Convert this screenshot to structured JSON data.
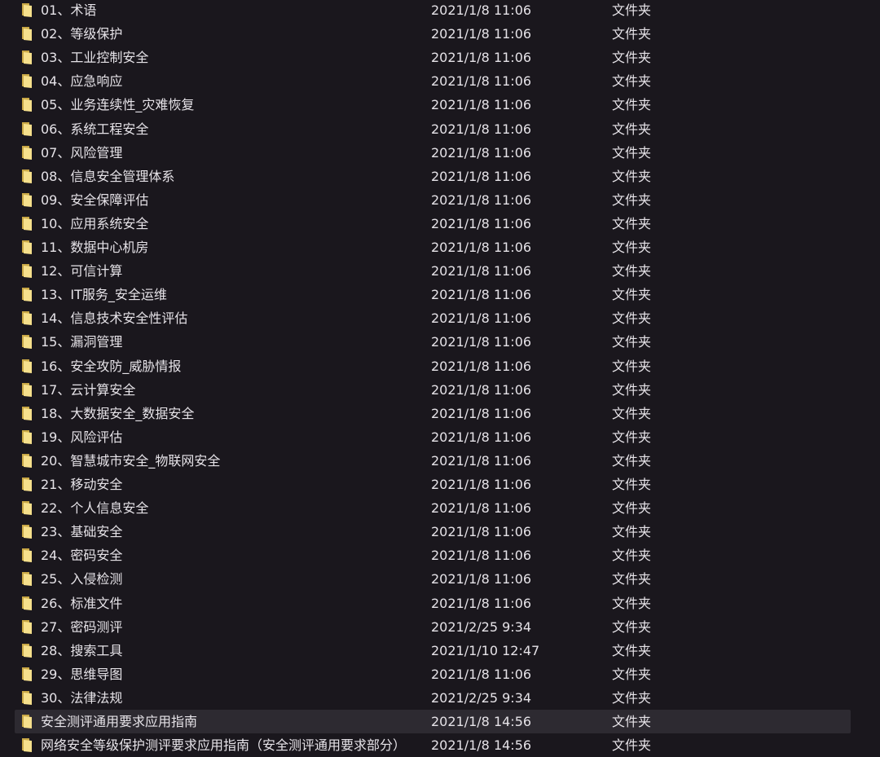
{
  "file_list": {
    "items": [
      {
        "name": "01、术语",
        "modified": "2021/1/8 11:06",
        "type": "文件夹"
      },
      {
        "name": "02、等级保护",
        "modified": "2021/1/8 11:06",
        "type": "文件夹"
      },
      {
        "name": "03、工业控制安全",
        "modified": "2021/1/8 11:06",
        "type": "文件夹"
      },
      {
        "name": "04、应急响应",
        "modified": "2021/1/8 11:06",
        "type": "文件夹"
      },
      {
        "name": "05、业务连续性_灾难恢复",
        "modified": "2021/1/8 11:06",
        "type": "文件夹"
      },
      {
        "name": "06、系统工程安全",
        "modified": "2021/1/8 11:06",
        "type": "文件夹"
      },
      {
        "name": "07、风险管理",
        "modified": "2021/1/8 11:06",
        "type": "文件夹"
      },
      {
        "name": "08、信息安全管理体系",
        "modified": "2021/1/8 11:06",
        "type": "文件夹"
      },
      {
        "name": "09、安全保障评估",
        "modified": "2021/1/8 11:06",
        "type": "文件夹"
      },
      {
        "name": "10、应用系统安全",
        "modified": "2021/1/8 11:06",
        "type": "文件夹"
      },
      {
        "name": "11、数据中心机房",
        "modified": "2021/1/8 11:06",
        "type": "文件夹"
      },
      {
        "name": "12、可信计算",
        "modified": "2021/1/8 11:06",
        "type": "文件夹"
      },
      {
        "name": "13、IT服务_安全运维",
        "modified": "2021/1/8 11:06",
        "type": "文件夹"
      },
      {
        "name": "14、信息技术安全性评估",
        "modified": "2021/1/8 11:06",
        "type": "文件夹"
      },
      {
        "name": "15、漏洞管理",
        "modified": "2021/1/8 11:06",
        "type": "文件夹"
      },
      {
        "name": "16、安全攻防_威胁情报",
        "modified": "2021/1/8 11:06",
        "type": "文件夹"
      },
      {
        "name": "17、云计算安全",
        "modified": "2021/1/8 11:06",
        "type": "文件夹"
      },
      {
        "name": "18、大数据安全_数据安全",
        "modified": "2021/1/8 11:06",
        "type": "文件夹"
      },
      {
        "name": "19、风险评估",
        "modified": "2021/1/8 11:06",
        "type": "文件夹"
      },
      {
        "name": "20、智慧城市安全_物联网安全",
        "modified": "2021/1/8 11:06",
        "type": "文件夹"
      },
      {
        "name": "21、移动安全",
        "modified": "2021/1/8 11:06",
        "type": "文件夹"
      },
      {
        "name": "22、个人信息安全",
        "modified": "2021/1/8 11:06",
        "type": "文件夹"
      },
      {
        "name": "23、基础安全",
        "modified": "2021/1/8 11:06",
        "type": "文件夹"
      },
      {
        "name": "24、密码安全",
        "modified": "2021/1/8 11:06",
        "type": "文件夹"
      },
      {
        "name": "25、入侵检测",
        "modified": "2021/1/8 11:06",
        "type": "文件夹"
      },
      {
        "name": "26、标准文件",
        "modified": "2021/1/8 11:06",
        "type": "文件夹"
      },
      {
        "name": "27、密码测评",
        "modified": "2021/2/25 9:34",
        "type": "文件夹"
      },
      {
        "name": "28、搜索工具",
        "modified": "2021/1/10 12:47",
        "type": "文件夹"
      },
      {
        "name": "29、思维导图",
        "modified": "2021/1/8 11:06",
        "type": "文件夹"
      },
      {
        "name": "30、法律法规",
        "modified": "2021/2/25 9:34",
        "type": "文件夹"
      },
      {
        "name": "安全测评通用要求应用指南",
        "modified": "2021/1/8 14:56",
        "type": "文件夹",
        "selected": true
      },
      {
        "name": "网络安全等级保护测评要求应用指南（安全测评通用要求部分）",
        "modified": "2021/1/8 14:56",
        "type": "文件夹"
      }
    ]
  },
  "colors": {
    "background": "#1a171d",
    "text": "#e6e3e8",
    "row_selected": "#2d2a31",
    "folder_front": "#f6e08c",
    "folder_back": "#c9a846"
  },
  "icons": {
    "folder": "folder-icon"
  }
}
